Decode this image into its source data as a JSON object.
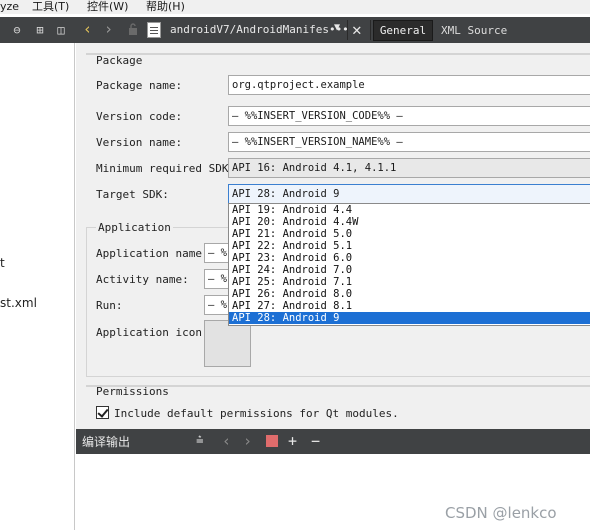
{
  "menubar": {
    "items": [
      "yze",
      "工具(T)",
      "控件(W)",
      "帮助(H)"
    ]
  },
  "left_pane": {
    "fragments": [
      "t",
      "st.xml"
    ]
  },
  "editor_toolbar": {
    "filename": "androidV7/AndroidManifes•••",
    "tabs": [
      "General",
      "XML Source"
    ],
    "active_tab": "General"
  },
  "package_section": {
    "title": "Package",
    "package_name_label": "Package name:",
    "package_name_value": "org.qtproject.example",
    "version_code_label": "Version code:",
    "version_code_value": "— %%INSERT_VERSION_CODE%% —",
    "version_name_label": "Version name:",
    "version_name_value": "— %%INSERT_VERSION_NAME%% —",
    "min_sdk_label": "Minimum required SDK:",
    "min_sdk_value": "API 16: Android 4.1, 4.1.1",
    "target_sdk_label": "Target SDK:",
    "target_sdk_value": "API 28: Android 9"
  },
  "target_sdk_options": [
    "API 19: Android 4.4",
    "API 20: Android 4.4W",
    "API 21: Android 5.0",
    "API 22: Android 5.1",
    "API 23: Android 6.0",
    "API 24: Android 7.0",
    "API 25: Android 7.1",
    "API 26: Android 8.0",
    "API 27: Android 8.1",
    "API 28: Android 9"
  ],
  "target_sdk_selected_index": 9,
  "application_section": {
    "title": "Application",
    "app_name_label": "Application name:",
    "activity_name_label": "Activity name:",
    "run_label": "Run:",
    "app_icon_label": "Application icon:",
    "partial_value": "— %"
  },
  "permissions_section": {
    "title": "Permissions",
    "include_default_label": "Include default permissions for Qt modules.",
    "include_default_checked": true
  },
  "output_bar": {
    "title": "编译输出"
  },
  "watermark": "CSDN @lenkco",
  "colors": {
    "dark_toolbar": "#404244",
    "selection": "#1c6fd4",
    "stop_button": "#e06c6c"
  }
}
